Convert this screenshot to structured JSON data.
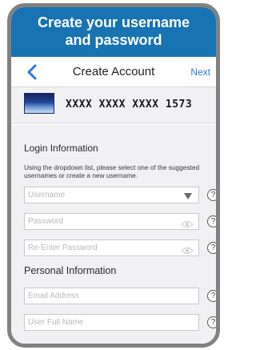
{
  "hero": {
    "line1": "Create your username",
    "line2": "and password"
  },
  "navbar": {
    "title": "Create Account",
    "next_label": "Next",
    "back_icon": "chevron-left-icon"
  },
  "card": {
    "number": "XXXX XXXX XXXX 1573"
  },
  "login": {
    "title": "Login Information",
    "help": "Using the dropdown list, please select one of the suggested usernames or create a new username.",
    "username_placeholder": "Username",
    "password_placeholder": "Password",
    "reenter_placeholder": "Re-Enter Password",
    "help_symbol": "?"
  },
  "personal": {
    "title": "Personal Information",
    "email_placeholder": "Email Address",
    "fullname_placeholder": "User Full Name"
  },
  "colors": {
    "header_blue": "#1873b2",
    "accent_blue": "#2a7bd0",
    "frame_gray": "#818181"
  }
}
